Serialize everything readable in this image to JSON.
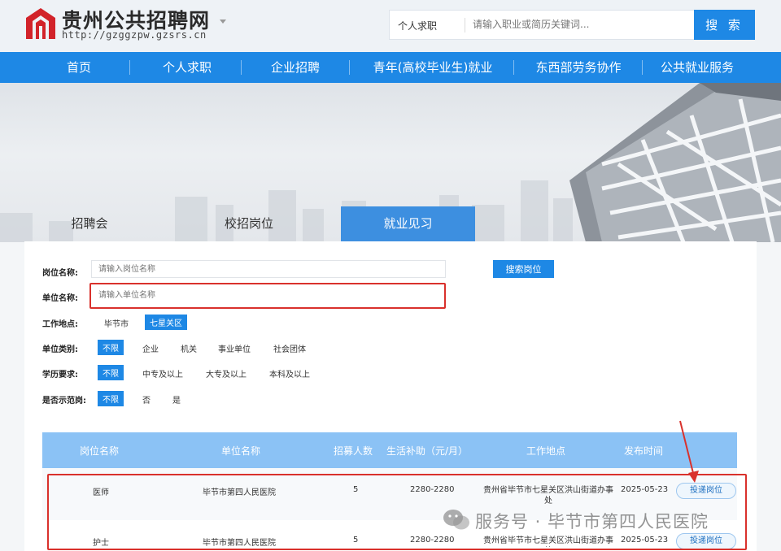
{
  "site": {
    "name": "贵州公共招聘网",
    "url": "http://gzggzpw.gzsrs.cn"
  },
  "search": {
    "type": "个人求职",
    "placeholder": "请输入职业或简历关键词...",
    "button": "搜 索"
  },
  "nav": [
    "首页",
    "个人求职",
    "企业招聘",
    "青年(高校毕业生)就业",
    "东西部劳务协作",
    "公共就业服务"
  ],
  "tabs": [
    "招聘会",
    "校招岗位",
    "就业见习"
  ],
  "active_tab": "就业见习",
  "filters": {
    "post_name_label": "岗位名称:",
    "post_name_placeholder": "请输入岗位名称",
    "unit_name_label": "单位名称:",
    "unit_name_placeholder": "请输入单位名称",
    "search_button": "搜索岗位",
    "location_label": "工作地点:",
    "location_options": [
      "毕节市",
      "七星关区"
    ],
    "location_selected": "七星关区",
    "unit_type_label": "单位类别:",
    "unit_type_options": [
      "不限",
      "企业",
      "机关",
      "事业单位",
      "社会团体"
    ],
    "education_label": "学历要求:",
    "education_options": [
      "不限",
      "中专及以上",
      "大专及以上",
      "本科及以上"
    ],
    "demo_label": "是否示范岗:",
    "demo_options": [
      "不限",
      "否",
      "是"
    ]
  },
  "table": {
    "headers": [
      "岗位名称",
      "单位名称",
      "招募人数",
      "生活补助（元/月）",
      "工作地点",
      "发布时间"
    ],
    "rows": [
      {
        "post": "医师",
        "unit": "毕节市第四人民医院",
        "count": "5",
        "subsidy": "2280-2280",
        "location": "贵州省毕节市七星关区洪山街道办事处",
        "date": "2025-05-23",
        "action": "投递岗位"
      },
      {
        "post": "护士",
        "unit": "毕节市第四人民医院",
        "count": "5",
        "subsidy": "2280-2280",
        "location": "贵州省毕节市七星关区洪山街道办事处",
        "date": "2025-05-23",
        "action": "投递岗位"
      }
    ]
  },
  "watermark": "服务号 · 毕节市第四人民医院",
  "colors": {
    "primary": "#1e88e5",
    "table_header": "#8bc2f5",
    "highlight": "#d9312c",
    "logo_red": "#d2232a"
  }
}
